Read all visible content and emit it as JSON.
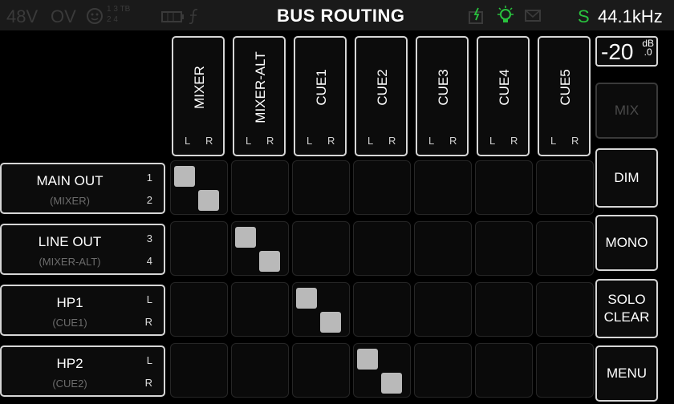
{
  "status": {
    "phantom": "48V",
    "overload": "OV",
    "inputs_top": "1 3 TB",
    "inputs_bottom": "2 4",
    "title": "BUS ROUTING",
    "s_indicator": "S",
    "sample_rate": "44.1kHz",
    "colors": {
      "dim": "#3a3a3a",
      "accent": "#29c23e"
    }
  },
  "level": {
    "value": "-20",
    "unit": "dB",
    "decimal": ".0"
  },
  "columns": [
    {
      "name": "MIXER",
      "left": "L",
      "right": "R"
    },
    {
      "name": "MIXER-ALT",
      "left": "L",
      "right": "R"
    },
    {
      "name": "CUE1",
      "left": "L",
      "right": "R"
    },
    {
      "name": "CUE2",
      "left": "L",
      "right": "R"
    },
    {
      "name": "CUE3",
      "left": "L",
      "right": "R"
    },
    {
      "name": "CUE4",
      "left": "L",
      "right": "R"
    },
    {
      "name": "CUE5",
      "left": "L",
      "right": "R"
    }
  ],
  "rows": [
    {
      "name": "MAIN OUT",
      "source": "(MIXER)",
      "ch1": "1",
      "ch2": "2",
      "routed_column": 0
    },
    {
      "name": "LINE OUT",
      "source": "(MIXER-ALT)",
      "ch1": "3",
      "ch2": "4",
      "routed_column": 1
    },
    {
      "name": "HP1",
      "source": "(CUE1)",
      "ch1": "L",
      "ch2": "R",
      "routed_column": 2
    },
    {
      "name": "HP2",
      "source": "(CUE2)",
      "ch1": "L",
      "ch2": "R",
      "routed_column": 3
    }
  ],
  "buttons": {
    "mix": "MIX",
    "dim": "DIM",
    "mono": "MONO",
    "solo_clear_1": "SOLO",
    "solo_clear_2": "CLEAR",
    "menu": "MENU"
  }
}
